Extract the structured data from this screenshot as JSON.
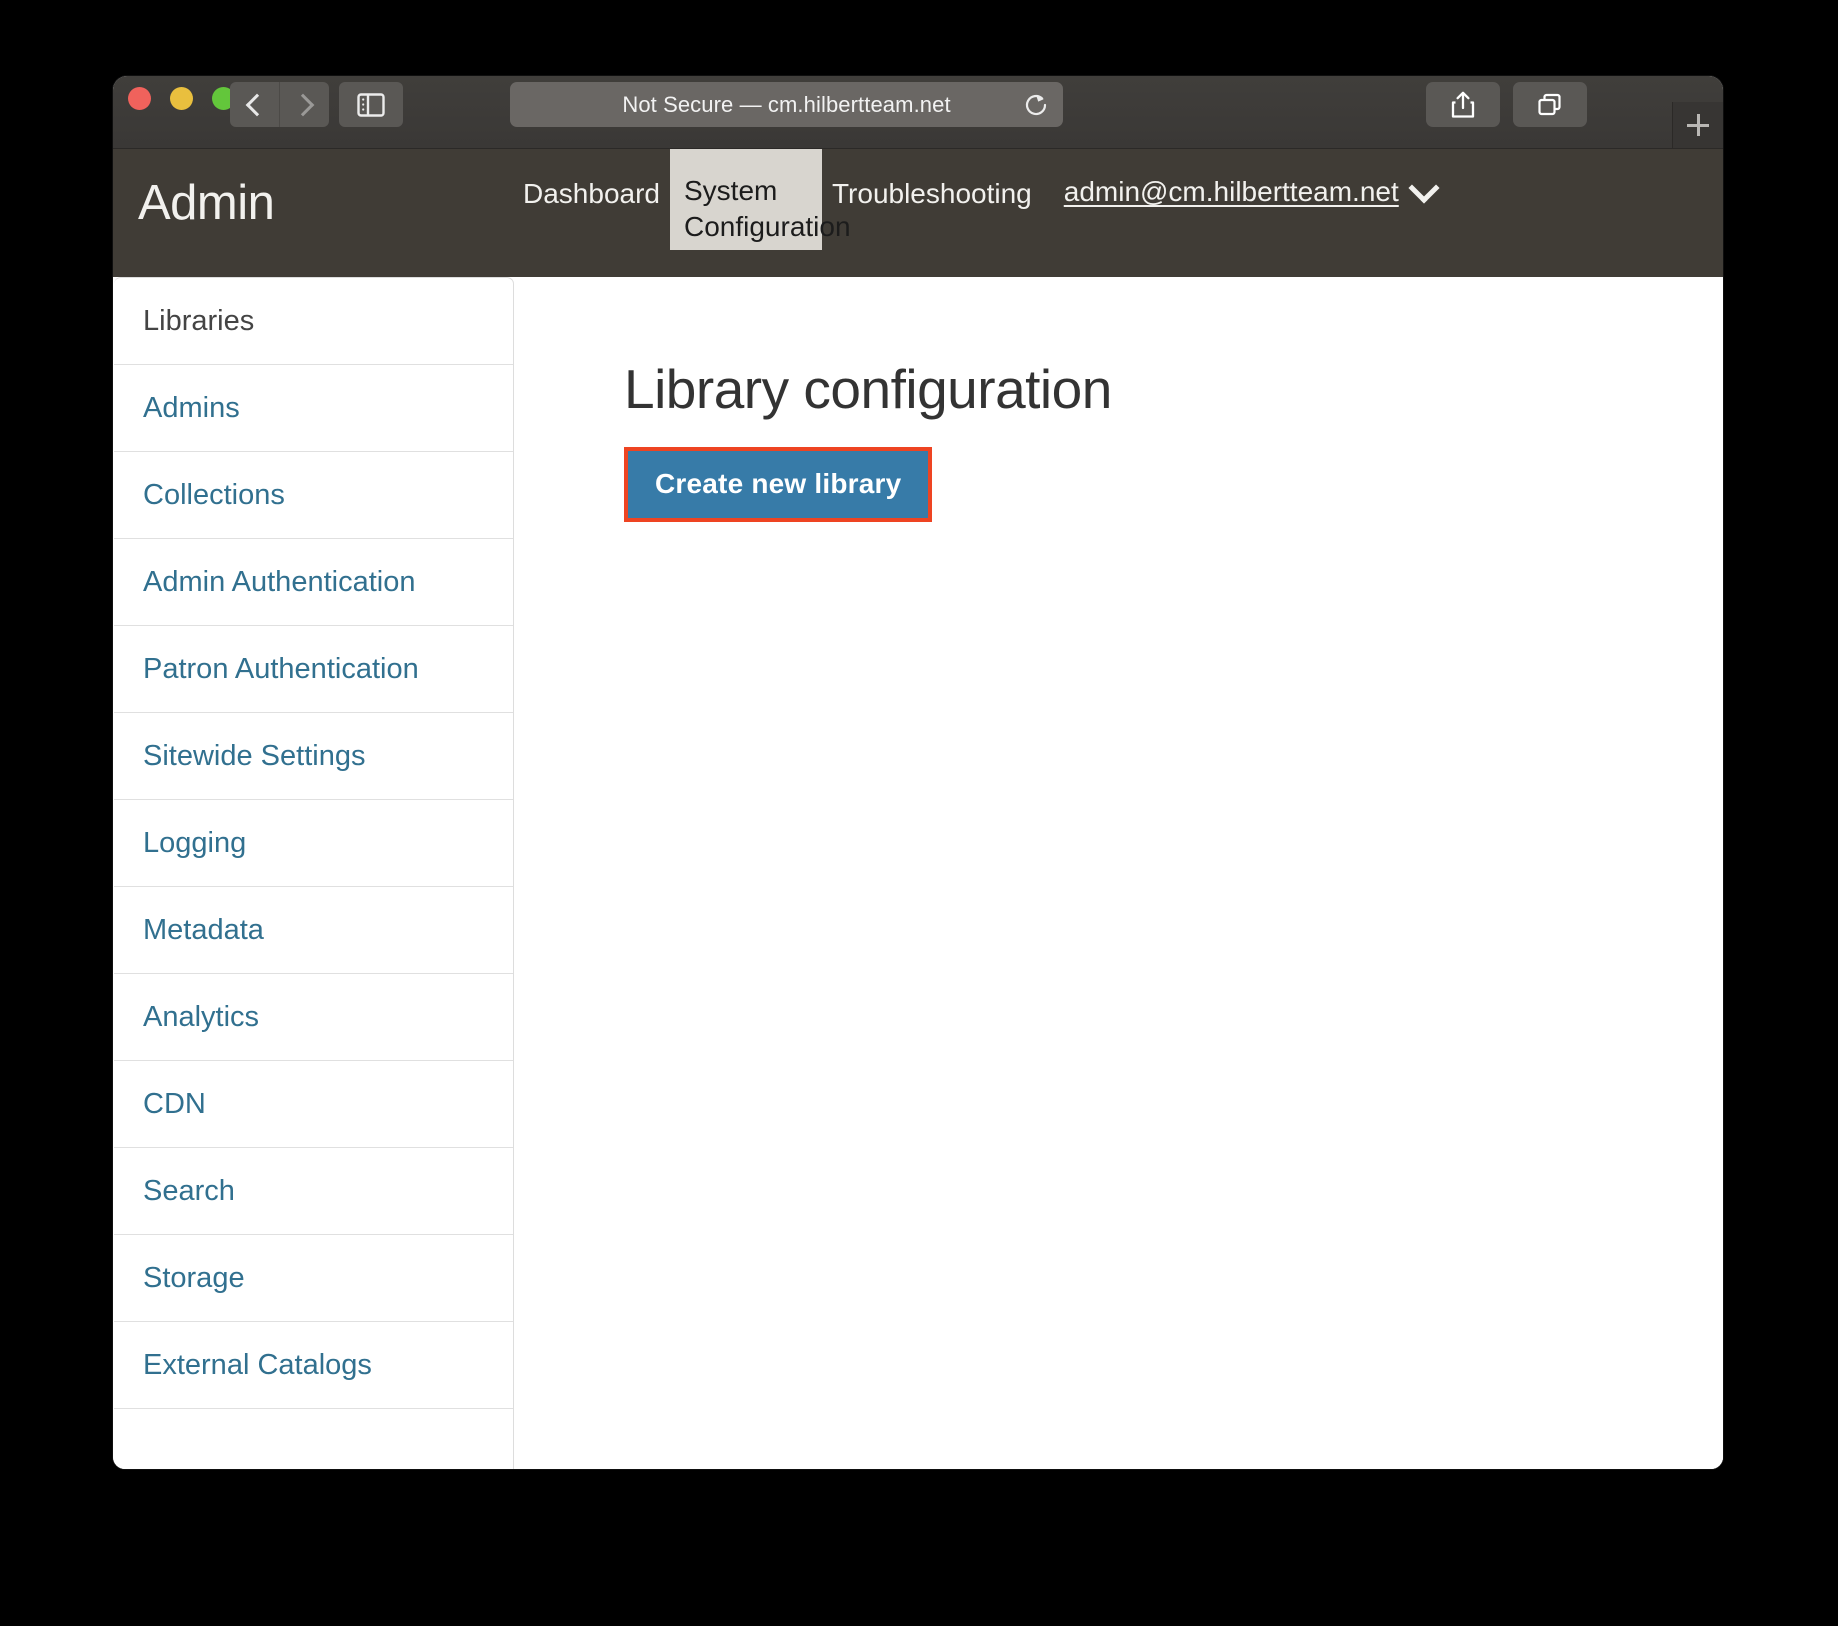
{
  "browser": {
    "traffic_lights": [
      "close",
      "minimize",
      "maximize"
    ],
    "back_label": "Back",
    "forward_label": "Forward",
    "sidebar_toggle_label": "Show Sidebar",
    "url_security": "Not Secure",
    "url_separator": " — ",
    "url_host": "cm.hilbertteam.net",
    "url_full": "Not Secure — cm.hilbertteam.net",
    "reload_label": "Reload",
    "share_label": "Share",
    "tab_overview_label": "Tab Overview",
    "new_tab_label": "New Tab"
  },
  "header": {
    "title": "Admin",
    "nav": [
      {
        "label": "Dashboard",
        "active": false
      },
      {
        "label": "System Configuration",
        "active": true
      },
      {
        "label": "Troubleshooting",
        "active": false
      }
    ],
    "account_email": "admin@cm.hilbertteam.net"
  },
  "sidebar": {
    "items": [
      {
        "label": "Libraries",
        "active": true
      },
      {
        "label": "Admins",
        "active": false
      },
      {
        "label": "Collections",
        "active": false
      },
      {
        "label": "Admin Authentication",
        "active": false
      },
      {
        "label": "Patron Authentication",
        "active": false
      },
      {
        "label": "Sitewide Settings",
        "active": false
      },
      {
        "label": "Logging",
        "active": false
      },
      {
        "label": "Metadata",
        "active": false
      },
      {
        "label": "Analytics",
        "active": false
      },
      {
        "label": "CDN",
        "active": false
      },
      {
        "label": "Search",
        "active": false
      },
      {
        "label": "Storage",
        "active": false
      },
      {
        "label": "External Catalogs",
        "active": false
      }
    ]
  },
  "main": {
    "page_title": "Library configuration",
    "create_button_label": "Create new library"
  },
  "colors": {
    "header_bg": "#403c36",
    "active_tab_bg": "#d8d5cf",
    "link_blue": "#31708f",
    "button_blue": "#377ba8",
    "highlight_red": "#ee4422",
    "titlebar_bg": "#3d3b38"
  }
}
